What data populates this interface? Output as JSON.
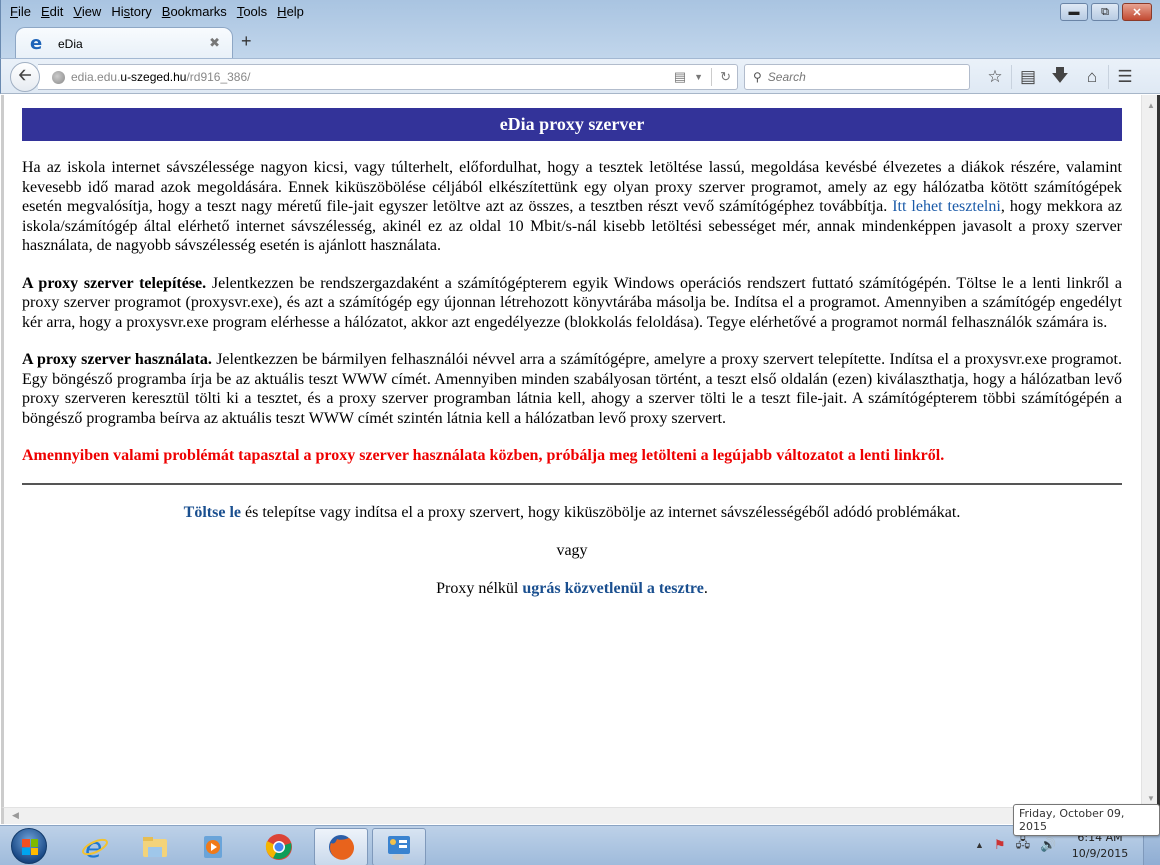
{
  "browser": {
    "menu": [
      "File",
      "Edit",
      "View",
      "History",
      "Bookmarks",
      "Tools",
      "Help"
    ],
    "menu_underline": [
      "F",
      "E",
      "V",
      "s",
      "B",
      "T",
      "H"
    ],
    "tab": {
      "title": "eDia",
      "favicon": "ie-e-icon"
    },
    "new_tab_label": "+",
    "url": {
      "host_prefix": "edia.edu.",
      "domain": "u-szeged.hu",
      "path": "/rd916_386/"
    },
    "search_placeholder": "Search",
    "toolbar_icons": [
      "bookmark-star-icon",
      "reading-list-icon",
      "downloads-icon",
      "home-icon",
      "menu-icon"
    ]
  },
  "page": {
    "banner_title": "eDia proxy szerver",
    "intro": {
      "before_link": "Ha az iskola internet sávszélessége nagyon kicsi, vagy túlterhelt, előfordulhat, hogy a tesztek letöltése lassú, megoldása kevésbé élvezetes a diákok részére, valamint kevesebb idő marad azok megoldására. Ennek kiküszöbölése céljából elkészítettünk egy olyan proxy szerver programot, amely az egy hálózatba kötött számítógépek esetén megvalósítja, hogy a teszt nagy méretű file-jait egyszer letöltve azt az összes, a tesztben részt vevő számítógéphez továbbítja. ",
      "link": "Itt lehet tesztelni",
      "after_link": ", hogy mekkora az iskola/számítógép által elérhető internet sávszélesség, akinél ez az oldal 10 Mbit/s-nál kisebb letöltési sebességet mér, annak mindenképpen javasolt a proxy szerver használata, de nagyobb sávszélesség esetén is ajánlott használata."
    },
    "install": {
      "heading": "A proxy szerver telepítése.",
      "text": " Jelentkezzen be rendszergazdaként a számítógépterem egyik Windows operációs rendszert futtató számítógépén. Töltse le a lenti linkről a proxy szerver programot (proxysvr.exe), és azt a számítógép egy újonnan létrehozott könyvtárába másolja be. Indítsa el a programot. Amennyiben a számítógép engedélyt kér arra, hogy a proxysvr.exe program elérhesse a hálózatot, akkor azt engedélyezze (blokkolás feloldása). Tegye elérhetővé a programot normál felhasználók számára is."
    },
    "usage": {
      "heading": "A proxy szerver használata.",
      "text": " Jelentkezzen be bármilyen felhasználói névvel arra a számítógépre, amelyre a proxy szervert telepítette. Indítsa el a proxysvr.exe programot. Egy böngésző programba írja be az aktuális teszt WWW címét. Amennyiben minden szabályosan történt, a teszt első oldalán (ezen) kiválaszthatja, hogy a hálózatban levő proxy szerveren keresztül tölti ki a tesztet, és a proxy szerver programban látnia kell, ahogy a szerver tölti le a teszt file-jait. A számítógépterem többi számítógépén a böngésző programba beírva az aktuális teszt WWW címét szintén látnia kell a hálózatban levő proxy szervert."
    },
    "warning": "Amennyiben valami problémát tapasztal a proxy szerver használata közben, próbálja meg letölteni a legújabb változatot a lenti linkről.",
    "download": {
      "link": "Töltse le",
      "text": " és telepítse vagy indítsa el a proxy szervert, hogy kiküszöbölje az internet sávszélességéből adódó problémákat."
    },
    "or_label": "vagy",
    "direct": {
      "before": "Proxy nélkül ",
      "link": "ugrás közvetlenül a tesztre",
      "after": "."
    },
    "colors": {
      "banner": "#333399",
      "link": "#1a5aa8",
      "warning": "#ee0000"
    }
  },
  "taskbar": {
    "items": [
      "start-button",
      "internet-explorer",
      "windows-explorer",
      "windows-media-player",
      "google-chrome",
      "firefox",
      "control-panel"
    ],
    "tooltip": "Friday, October 09, 2015",
    "time": "6:14 AM",
    "date": "10/9/2015"
  }
}
